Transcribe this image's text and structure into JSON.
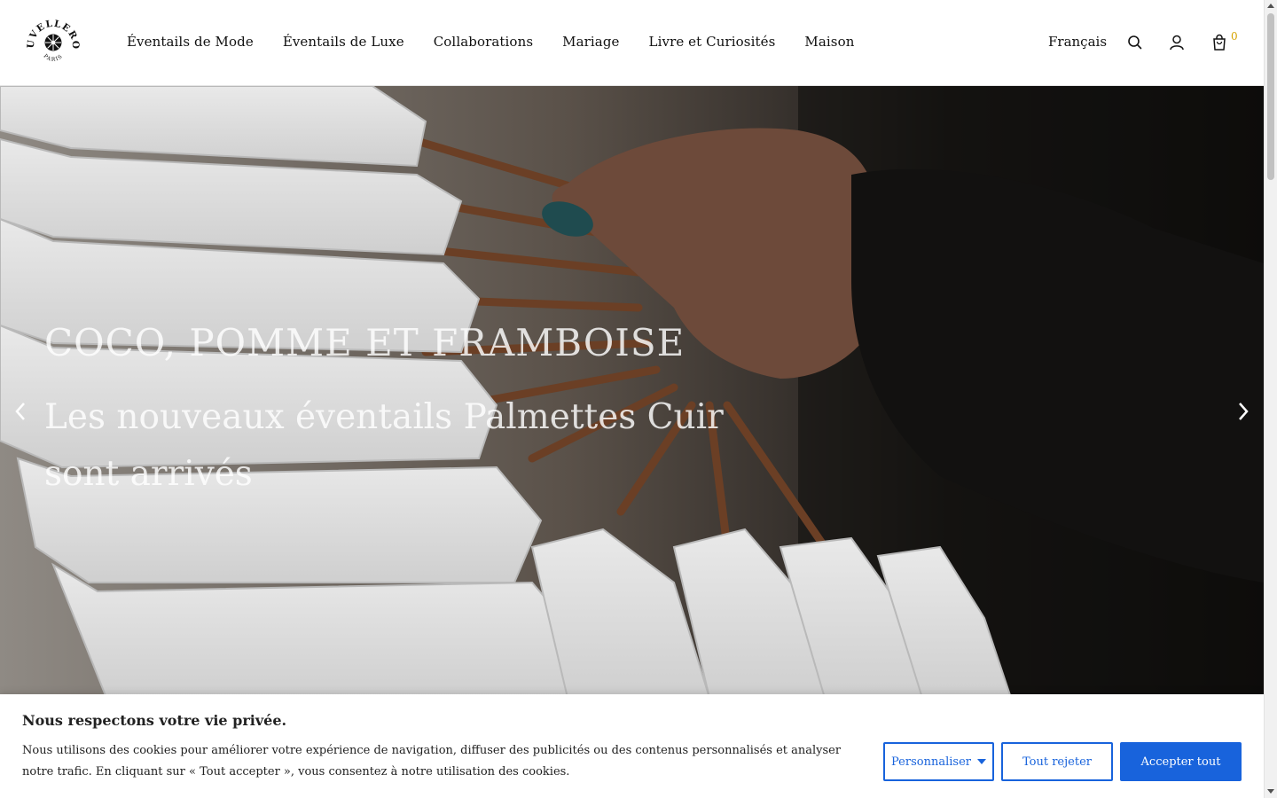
{
  "brand": {
    "name": "DUVELLEROY",
    "city": "PARIS"
  },
  "nav": {
    "items": [
      {
        "label": "Éventails de Mode"
      },
      {
        "label": "Éventails de Luxe"
      },
      {
        "label": "Collaborations"
      },
      {
        "label": "Mariage"
      },
      {
        "label": "Livre et Curiosités"
      },
      {
        "label": "Maison"
      }
    ]
  },
  "tools": {
    "language": "Français",
    "search_icon": "search-icon",
    "account_icon": "user-icon",
    "cart_icon": "shopping-bag-icon",
    "cart_count": "0",
    "cart_count_color": "#d6a300"
  },
  "hero": {
    "kicker": "COCO, POMME ET FRAMBOISE",
    "title": "Les nouveaux éventails Palmettes Cuir sont arrivés",
    "prev_icon": "chevron-left-icon",
    "next_icon": "chevron-right-icon"
  },
  "cookie": {
    "title": "Nous respectons votre vie privée.",
    "text": "Nous utilisons des cookies pour améliorer votre expérience de navigation, diffuser des publicités ou des contenus personnalisés et analyser notre trafic. En cliquant sur « Tout accepter », vous consentez à notre utilisation des cookies.",
    "customize_label": "Personnaliser",
    "reject_label": "Tout rejeter",
    "accept_label": "Accepter tout",
    "accent_color": "#1863dc"
  }
}
